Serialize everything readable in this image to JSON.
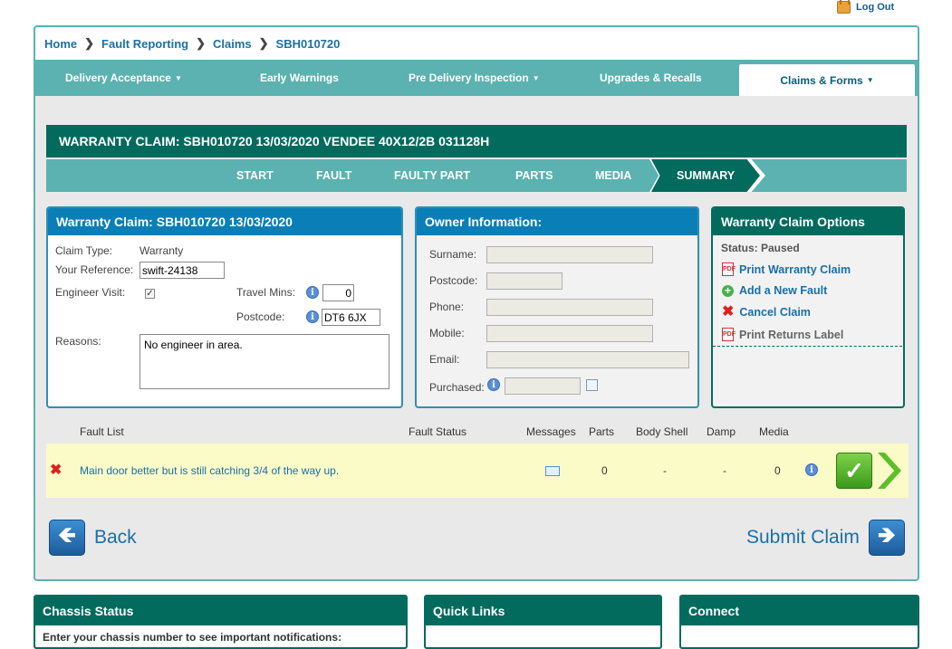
{
  "header": {
    "logout": "Log Out"
  },
  "breadcrumb": [
    "Home",
    "Fault Reporting",
    "Claims",
    "SBH010720"
  ],
  "topnav": [
    {
      "label": "Delivery Acceptance",
      "dropdown": true
    },
    {
      "label": "Early Warnings",
      "dropdown": false
    },
    {
      "label": "Pre Delivery Inspection",
      "dropdown": true
    },
    {
      "label": "Upgrades & Recalls",
      "dropdown": false
    },
    {
      "label": "Claims & Forms",
      "dropdown": true,
      "active": true
    }
  ],
  "claim_title": "WARRANTY CLAIM: SBH010720 13/03/2020 VENDEE 40X12/2B 031128H",
  "steps": [
    "START",
    "FAULT",
    "FAULTY PART",
    "PARTS",
    "MEDIA",
    "SUMMARY"
  ],
  "active_step": "SUMMARY",
  "claim_panel": {
    "title": "Warranty Claim: SBH010720 13/03/2020",
    "claim_type_label": "Claim Type:",
    "claim_type": "Warranty",
    "reference_label": "Your Reference:",
    "reference": "swift-24138",
    "engineer_label": "Engineer Visit:",
    "engineer_checked": true,
    "travel_label": "Travel Mins:",
    "travel": "0",
    "postcode_label": "Postcode:",
    "postcode": "DT6 6JX",
    "reasons_label": "Reasons:",
    "reasons": "No engineer in area."
  },
  "owner_panel": {
    "title": "Owner Information:",
    "surname_label": "Surname:",
    "postcode_label": "Postcode:",
    "phone_label": "Phone:",
    "mobile_label": "Mobile:",
    "email_label": "Email:",
    "purchased_label": "Purchased:"
  },
  "options_panel": {
    "title": "Warranty Claim Options",
    "status": "Status: Paused",
    "print_claim": "Print Warranty Claim",
    "add_fault": "Add a New Fault",
    "cancel_claim": "Cancel Claim",
    "print_label": "Print Returns Label"
  },
  "fault_table": {
    "headers": [
      "Fault List",
      "Fault Status",
      "Messages",
      "Parts",
      "Body Shell",
      "Damp",
      "Media"
    ],
    "rows": [
      {
        "fault": "Main door better but is still catching 3/4 of the way up.",
        "status": "",
        "parts": "0",
        "body_shell": "-",
        "damp": "-",
        "media": "0"
      }
    ]
  },
  "actions": {
    "back": "Back",
    "submit": "Submit Claim"
  },
  "bottom": {
    "chassis_title": "Chassis Status",
    "chassis_text": "Enter your chassis number to see important notifications:",
    "quicklinks_title": "Quick Links",
    "connect_title": "Connect"
  },
  "colors": {
    "teal_dark": "#036b5e",
    "teal_light": "#5bb2b0",
    "blue": "#0a7fb7",
    "link": "#1a6fa8",
    "row_highlight": "#fbfbc8"
  }
}
